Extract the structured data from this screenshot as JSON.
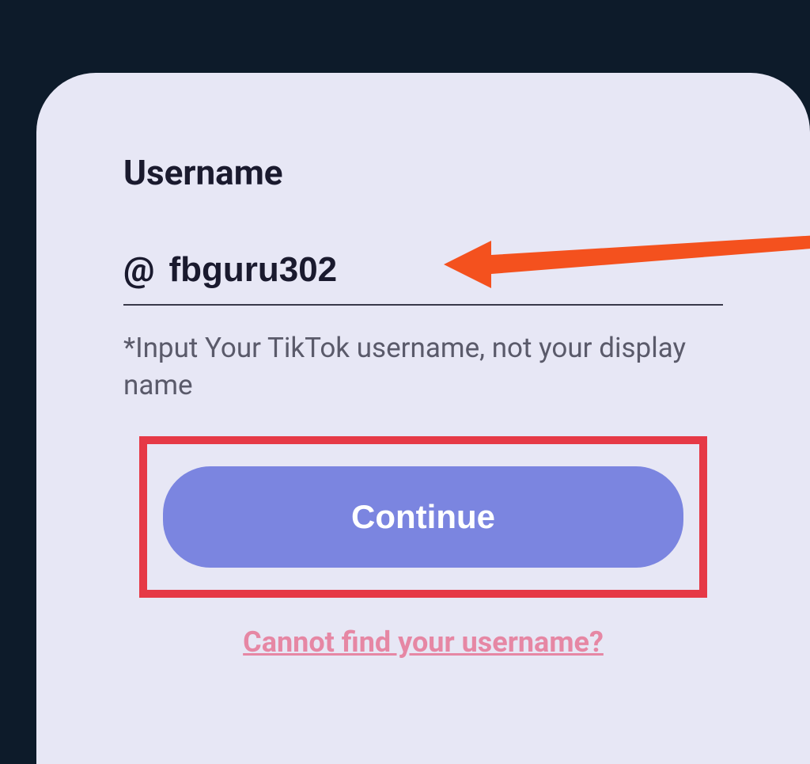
{
  "form": {
    "label": "Username",
    "at_prefix": "@",
    "username_value": "fbguru302",
    "helper_text": "*Input Your TikTok username, not your display name",
    "continue_label": "Continue",
    "help_link_label": "Cannot find your username?"
  },
  "annotation": {
    "arrow_color": "#f4511e",
    "highlight_color": "#e63946"
  }
}
